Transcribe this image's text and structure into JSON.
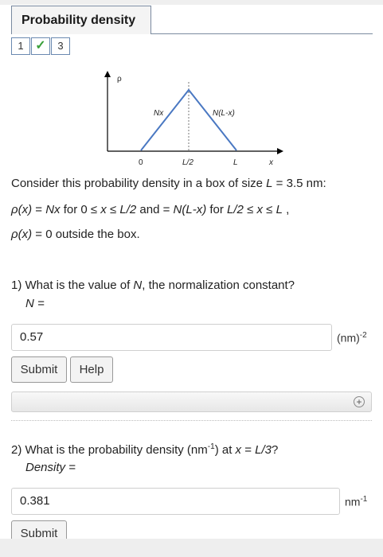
{
  "tab": {
    "title": "Probability density"
  },
  "parts": [
    {
      "label": "1"
    },
    {
      "label": "✓"
    },
    {
      "label": "3"
    }
  ],
  "diagram": {
    "ylabel": "ρ",
    "xlabel": "x",
    "tick_0": "0",
    "tick_half": "L/2",
    "tick_L": "L",
    "left_label": "Nx",
    "right_label": "N(L-x)"
  },
  "text": {
    "line1_a": "Consider this probability density in a box of size ",
    "line1_L": "L",
    "line1_b": " = 3.5 nm:",
    "line2_rho": "ρ(x)",
    "line2_a": " = ",
    "line2_Nx": "Nx",
    "line2_b": " for 0 ≤ ",
    "line2_x1": "x",
    "line2_c": " ≤ ",
    "line2_L2a": "L/2",
    "line2_d": " and = ",
    "line2_NLx": "N(L-x)",
    "line2_e": " for ",
    "line2_L2b": "L/2",
    "line2_f": " ≤ ",
    "line2_x2": "x",
    "line2_g": " ≤ ",
    "line2_L": "L",
    "line2_h": " ,",
    "line3_rho": "ρ(x)",
    "line3_a": " = 0 outside the box."
  },
  "q1": {
    "prefix": "1) What is the value of ",
    "N": "N",
    "suffix": ", the normalization constant?",
    "label": "N =",
    "value": "0.57",
    "unit": "(nm)",
    "unit_exp": "-2",
    "submit": "Submit",
    "help": "Help"
  },
  "panel": {
    "icon": "+"
  },
  "q2": {
    "prefix": "2) What is the probability density (nm",
    "exp": "-1",
    "mid": ") at ",
    "x": "x",
    "eq": " = ",
    "L3": "L/3",
    "q": "?",
    "label": "Density =",
    "value": "0.381",
    "unit": "nm",
    "unit_exp": "-1",
    "submit": "Submit"
  }
}
